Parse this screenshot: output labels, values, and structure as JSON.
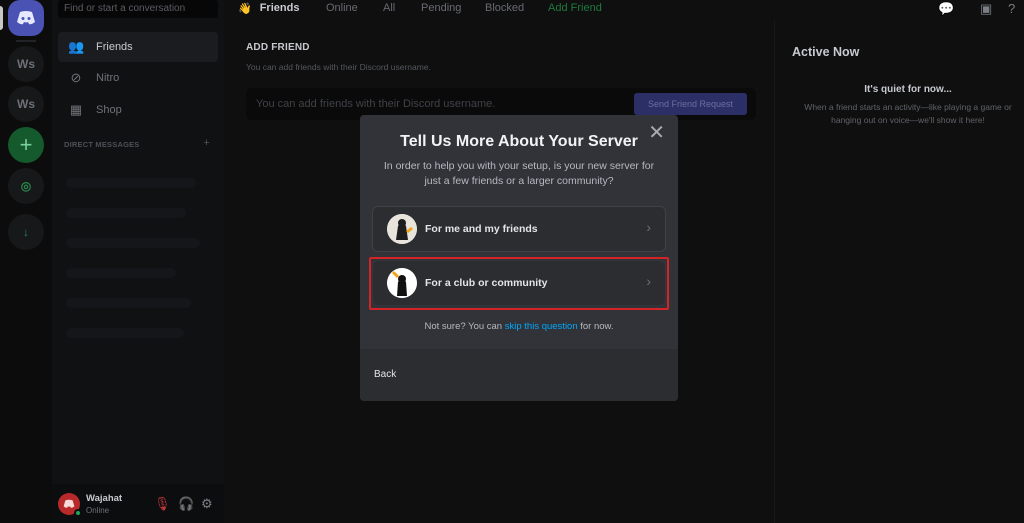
{
  "search": {
    "placeholder": "Find or start a conversation"
  },
  "rail": {
    "servers": [
      "Ws",
      "Ws"
    ],
    "add_symbol": "+",
    "explore_symbol": "◎",
    "download_symbol": "↓"
  },
  "sidebar": {
    "items": [
      {
        "label": "Friends",
        "icon": "friends-icon"
      },
      {
        "label": "Nitro",
        "icon": "nitro-icon"
      },
      {
        "label": "Shop",
        "icon": "shop-icon"
      }
    ],
    "dm_header": "DIRECT MESSAGES",
    "dm_add": "+"
  },
  "user": {
    "name": "Wajahat",
    "status": "Online"
  },
  "topbar": {
    "title": "Friends",
    "tabs": [
      "Online",
      "All",
      "Pending",
      "Blocked"
    ],
    "add_friend": "Add Friend"
  },
  "main": {
    "title": "ADD FRIEND",
    "subtitle": "You can add friends with their Discord username.",
    "input_placeholder": "You can add friends with their Discord username.",
    "send_button": "Send Friend Request"
  },
  "active_now": {
    "title": "Active Now",
    "quiet_title": "It's quiet for now...",
    "quiet_text": "When a friend starts an activity—like playing a game or hanging out on voice—we'll show it here!"
  },
  "modal": {
    "title": "Tell Us More About Your Server",
    "subtitle": "In order to help you with your setup, is your new server for just a few friends or a larger community?",
    "options": [
      {
        "label": "For me and my friends",
        "icon": "friends-illustration-icon"
      },
      {
        "label": "For a club or community",
        "icon": "community-illustration-icon"
      }
    ],
    "not_sure_prefix": "Not sure? You can ",
    "not_sure_link": "skip this question",
    "not_sure_suffix": " for now.",
    "back": "Back",
    "close": "✕"
  },
  "colors": {
    "accent": "#5865f2",
    "highlight": "#d42428",
    "link": "#00a8fc",
    "online": "#23a55a"
  }
}
